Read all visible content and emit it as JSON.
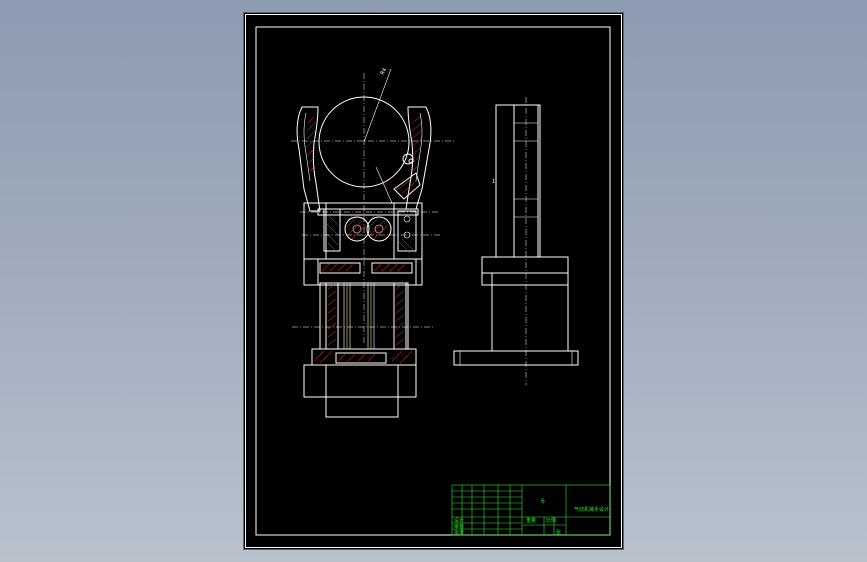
{
  "colors": {
    "background_top": "#8c9bb0",
    "background_bottom": "#b9c1cd",
    "sheet": "#000000",
    "line": "#ffffff",
    "section_hatch": "#ff3b3b",
    "title_block": "#2ee62e",
    "hidden_edge": "#ffd84a"
  },
  "drawing": {
    "title_block": {
      "sheet_mark": "6",
      "drawing_title": "气动机械手设计",
      "scale_label": "比例",
      "sheet_label": "张",
      "weight_label": "重量",
      "design_label": "设计",
      "check_label": "审核",
      "approve_label": "批准"
    }
  }
}
